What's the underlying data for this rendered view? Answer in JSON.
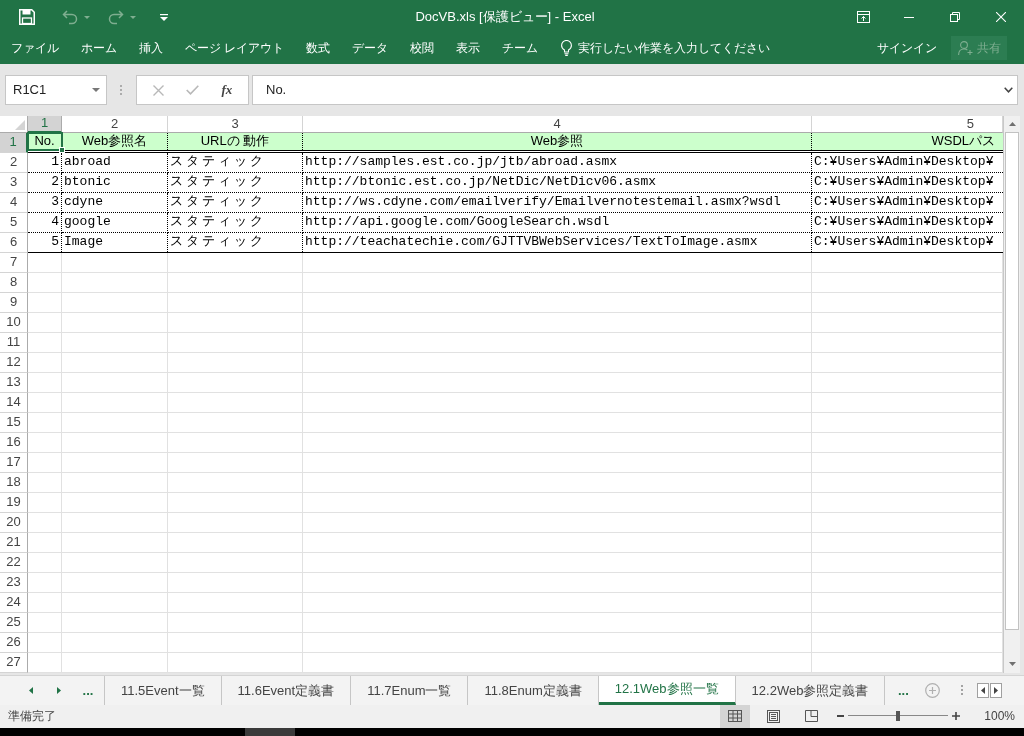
{
  "title_bar": {
    "title": "DocVB.xls [保護ビュー] - Excel",
    "quick_access": [
      {
        "kind": "save",
        "disabled": false
      },
      {
        "kind": "undo",
        "disabled": true
      },
      {
        "kind": "redo",
        "disabled": true
      },
      {
        "kind": "customize",
        "disabled": false
      }
    ]
  },
  "ribbon": {
    "tabs": [
      "ファイル",
      "ホーム",
      "挿入",
      "ページ レイアウト",
      "数式",
      "データ",
      "校閲",
      "表示",
      "チーム"
    ],
    "tell_me": {
      "placeholder": "実行したい作業を入力してください"
    },
    "sign_in": "サインイン",
    "share": {
      "label": "共有",
      "disabled": true
    }
  },
  "formula_bar": {
    "name_box": "R1C1",
    "edit_buttons_disabled": true,
    "function_label": "fx",
    "value": "No."
  },
  "grid": {
    "column_headers": [
      {
        "label": "1",
        "selected": true
      },
      {
        "label": "2",
        "selected": false
      },
      {
        "label": "3",
        "selected": false
      },
      {
        "label": "4",
        "selected": false
      },
      {
        "label": "5",
        "selected": false
      }
    ],
    "row_headers": [
      {
        "label": "1",
        "selected": true
      },
      {
        "label": "2",
        "selected": false
      },
      {
        "label": "3",
        "selected": false
      },
      {
        "label": "4",
        "selected": false
      },
      {
        "label": "5",
        "selected": false
      },
      {
        "label": "6",
        "selected": false
      },
      {
        "label": "7",
        "selected": false
      },
      {
        "label": "8",
        "selected": false
      },
      {
        "label": "9",
        "selected": false
      },
      {
        "label": "10",
        "selected": false
      },
      {
        "label": "11",
        "selected": false
      },
      {
        "label": "12",
        "selected": false
      },
      {
        "label": "13",
        "selected": false
      },
      {
        "label": "14",
        "selected": false
      },
      {
        "label": "15",
        "selected": false
      },
      {
        "label": "16",
        "selected": false
      },
      {
        "label": "17",
        "selected": false
      },
      {
        "label": "18",
        "selected": false
      },
      {
        "label": "19",
        "selected": false
      },
      {
        "label": "20",
        "selected": false
      },
      {
        "label": "21",
        "selected": false
      },
      {
        "label": "22",
        "selected": false
      },
      {
        "label": "23",
        "selected": false
      },
      {
        "label": "24",
        "selected": false
      },
      {
        "label": "25",
        "selected": false
      },
      {
        "label": "26",
        "selected": false
      },
      {
        "label": "27",
        "selected": false
      }
    ],
    "header_row": [
      {
        "text": "No.",
        "selected": true
      },
      {
        "text": "Web参照名",
        "selected": false
      },
      {
        "text": "URLの 動作",
        "selected": false
      },
      {
        "text": "Web参照",
        "selected": false
      },
      {
        "text": "WSDLパス",
        "selected": false
      }
    ],
    "rows": [
      [
        "1",
        "abroad",
        "スタティック",
        "http://samples.est.co.jp/jtb/abroad.asmx",
        "C:¥Users¥Admin¥Desktop¥"
      ],
      [
        "2",
        "btonic",
        "スタティック",
        "http://btonic.est.co.jp/NetDic/NetDicv06.asmx",
        "C:¥Users¥Admin¥Desktop¥"
      ],
      [
        "3",
        "cdyne",
        "スタティック",
        "http://ws.cdyne.com/emailverify/Emailvernotestemail.asmx?wsdl",
        "C:¥Users¥Admin¥Desktop¥"
      ],
      [
        "4",
        "google",
        "スタティック",
        "http://api.google.com/GoogleSearch.wsdl",
        "C:¥Users¥Admin¥Desktop¥"
      ],
      [
        "5",
        "Image",
        "スタティック",
        "http://teachatechie.com/GJTTVBWebServices/TextToImage.asmx",
        "C:¥Users¥Admin¥Desktop¥"
      ]
    ]
  },
  "sheet_bar": {
    "more_before": "...",
    "tabs": [
      {
        "label": "11.5Event一覧",
        "selected": false
      },
      {
        "label": "11.6Event定義書",
        "selected": false
      },
      {
        "label": "11.7Enum一覧",
        "selected": false
      },
      {
        "label": "11.8Enum定義書",
        "selected": false
      },
      {
        "label": "12.1Web参照一覧",
        "selected": true
      },
      {
        "label": "12.2Web参照定義書",
        "selected": false
      }
    ],
    "more_after": "..."
  },
  "status_bar": {
    "text": "準備完了",
    "views": [
      {
        "kind": "normal",
        "selected": true
      },
      {
        "kind": "page_layout",
        "selected": false
      },
      {
        "kind": "page_break",
        "selected": false
      }
    ],
    "zoom": {
      "level": 0.5,
      "reading": "100%"
    }
  }
}
